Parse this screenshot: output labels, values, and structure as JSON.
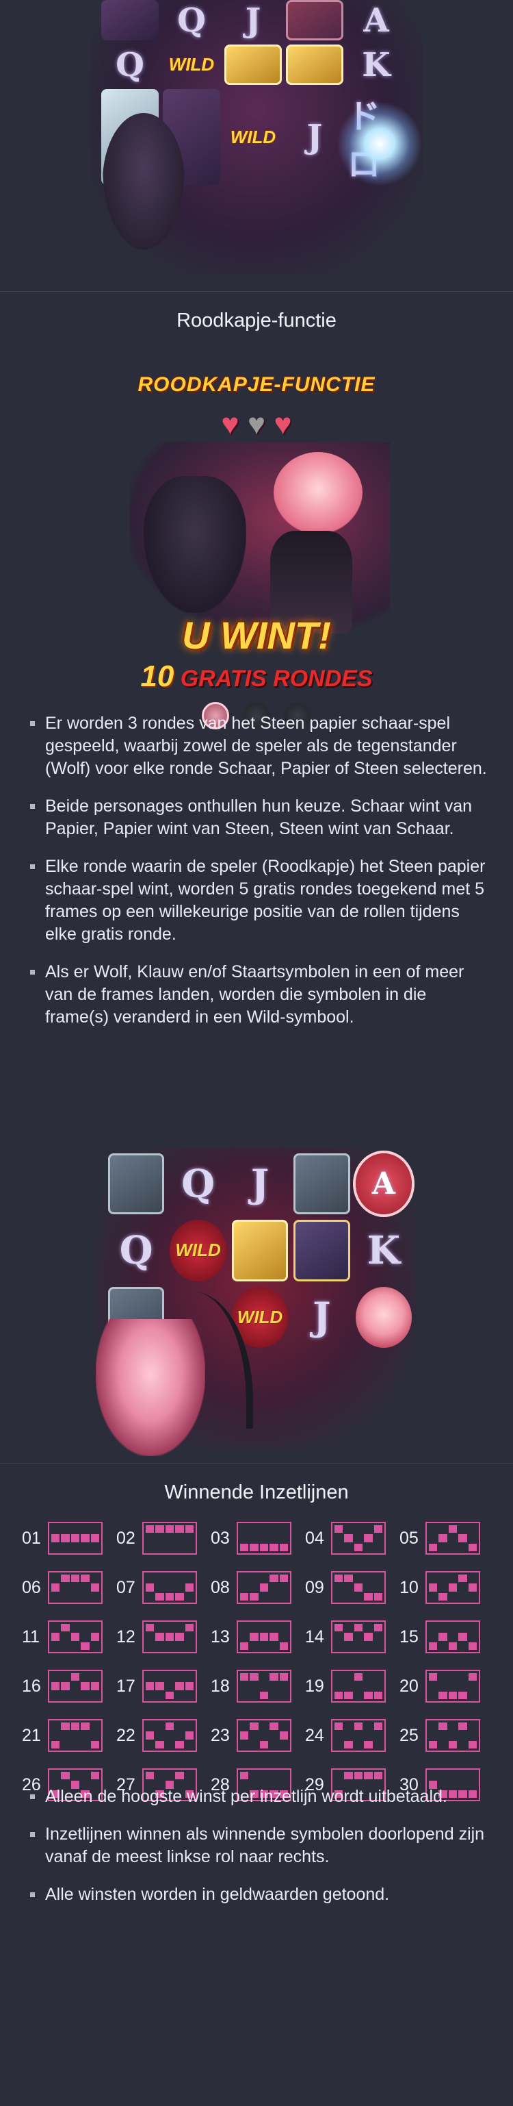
{
  "top_art": {
    "symbols": [
      "",
      "Q",
      "J",
      "",
      "A",
      "Q",
      "WILD",
      "",
      "",
      "K",
      "",
      "",
      "WILD",
      "J",
      "ドロ"
    ]
  },
  "feature": {
    "title": "Roodkapje-functie",
    "banner": "ROODKAPJE-FUNCTIE",
    "win_text": "U WINT!",
    "free_spins_count": "10",
    "free_spins_label": "GRATIS RONDES",
    "hearts": [
      "full",
      "broken",
      "full"
    ],
    "rules": [
      "Er worden 3 rondes van het Steen papier schaar-spel gespeeld, waarbij zowel de speler als de tegenstander (Wolf) voor elke ronde Schaar, Papier of Steen selecteren.",
      "Beide personages onthullen hun keuze. Schaar wint van Papier, Papier wint van Steen, Steen wint van Schaar.",
      "Elke ronde waarin de speler (Roodkapje) het Steen papier schaar-spel wint, worden 5 gratis rondes toegekend met 5 frames op een willekeurige positie van de rollen tijdens elke gratis ronde.",
      "Als er Wolf, Klauw en/of Staartsymbolen in een of meer van de frames landen, worden die symbolen in die frame(s) veranderd in een Wild-symbool."
    ]
  },
  "second_art": {
    "symbols": [
      "",
      "Q",
      "J",
      "",
      "A",
      "Q",
      "WILD",
      "",
      "",
      "K",
      "",
      "",
      "WILD",
      "J",
      ""
    ]
  },
  "paylines": {
    "title": "Winnende Inzetlijnen",
    "lines": [
      {
        "n": "01",
        "rows": [
          1,
          1,
          1,
          1,
          1
        ]
      },
      {
        "n": "02",
        "rows": [
          0,
          0,
          0,
          0,
          0
        ]
      },
      {
        "n": "03",
        "rows": [
          2,
          2,
          2,
          2,
          2
        ]
      },
      {
        "n": "04",
        "rows": [
          0,
          1,
          2,
          1,
          0
        ]
      },
      {
        "n": "05",
        "rows": [
          2,
          1,
          0,
          1,
          2
        ]
      },
      {
        "n": "06",
        "rows": [
          1,
          0,
          0,
          0,
          1
        ]
      },
      {
        "n": "07",
        "rows": [
          1,
          2,
          2,
          2,
          1
        ]
      },
      {
        "n": "08",
        "rows": [
          2,
          2,
          1,
          0,
          0
        ]
      },
      {
        "n": "09",
        "rows": [
          0,
          0,
          1,
          2,
          2
        ]
      },
      {
        "n": "10",
        "rows": [
          1,
          2,
          1,
          0,
          1
        ]
      },
      {
        "n": "11",
        "rows": [
          1,
          0,
          1,
          2,
          1
        ]
      },
      {
        "n": "12",
        "rows": [
          0,
          1,
          1,
          1,
          0
        ]
      },
      {
        "n": "13",
        "rows": [
          2,
          1,
          1,
          1,
          2
        ]
      },
      {
        "n": "14",
        "rows": [
          0,
          1,
          0,
          1,
          0
        ]
      },
      {
        "n": "15",
        "rows": [
          2,
          1,
          2,
          1,
          2
        ]
      },
      {
        "n": "16",
        "rows": [
          1,
          1,
          0,
          1,
          1
        ]
      },
      {
        "n": "17",
        "rows": [
          1,
          1,
          2,
          1,
          1
        ]
      },
      {
        "n": "18",
        "rows": [
          0,
          0,
          2,
          0,
          0
        ]
      },
      {
        "n": "19",
        "rows": [
          2,
          2,
          0,
          2,
          2
        ]
      },
      {
        "n": "20",
        "rows": [
          0,
          2,
          2,
          2,
          0
        ]
      },
      {
        "n": "21",
        "rows": [
          2,
          0,
          0,
          0,
          2
        ]
      },
      {
        "n": "22",
        "rows": [
          1,
          2,
          0,
          2,
          1
        ]
      },
      {
        "n": "23",
        "rows": [
          1,
          0,
          2,
          0,
          1
        ]
      },
      {
        "n": "24",
        "rows": [
          0,
          2,
          0,
          2,
          0
        ]
      },
      {
        "n": "25",
        "rows": [
          2,
          0,
          2,
          0,
          2
        ]
      },
      {
        "n": "26",
        "rows": [
          2,
          0,
          1,
          2,
          0
        ]
      },
      {
        "n": "27",
        "rows": [
          0,
          2,
          1,
          0,
          2
        ]
      },
      {
        "n": "28",
        "rows": [
          0,
          2,
          2,
          2,
          2
        ]
      },
      {
        "n": "29",
        "rows": [
          2,
          0,
          0,
          0,
          0
        ]
      },
      {
        "n": "30",
        "rows": [
          1,
          2,
          2,
          2,
          2
        ]
      }
    ]
  },
  "footer_rules": [
    "Alleen de hoogste winst per inzetlijn wordt uitbetaald.",
    "Inzetlijnen winnen als winnende symbolen doorlopend zijn vanaf de meest linkse rol naar rechts.",
    "Alle winsten worden in geldwaarden getoond."
  ],
  "colors": {
    "background": "#2b2d3a",
    "payline_accent": "#d9539f",
    "divider": "#3e4152"
  }
}
